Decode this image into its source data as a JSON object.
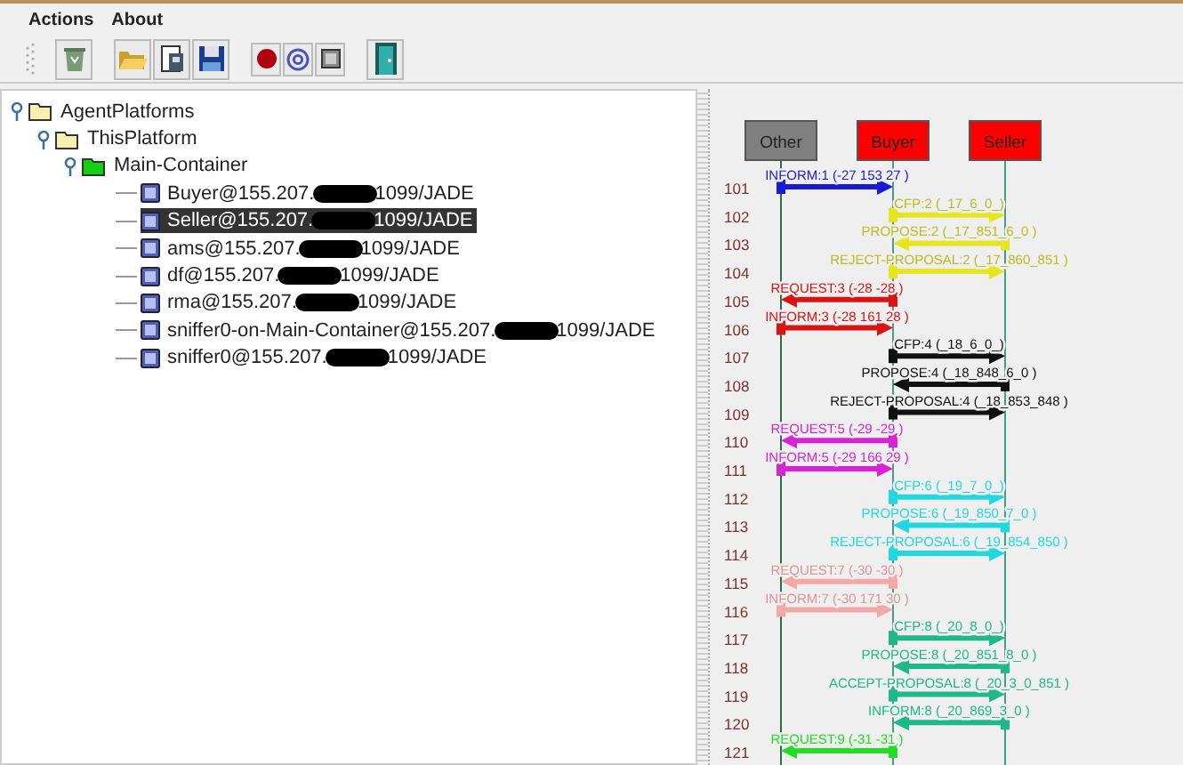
{
  "menu": [
    "Actions",
    "About"
  ],
  "tree": [
    {
      "label": "AgentPlatforms",
      "kind": "folder",
      "expanded": true,
      "children": [
        {
          "label": "ThisPlatform",
          "kind": "folder",
          "expanded": true,
          "children": [
            {
              "label": "Main-Container",
              "kind": "container",
              "expanded": true,
              "children": [
                {
                  "label_start": "Buyer@155.207.",
                  "label_end": "1099/JADE",
                  "selected": false
                },
                {
                  "label_start": "Seller@155.207.",
                  "label_end": "1099/JADE",
                  "selected": true
                },
                {
                  "label_start": "ams@155.207.",
                  "label_end": "1099/JADE",
                  "selected": false
                },
                {
                  "label_start": "df@155.207.",
                  "label_end": "1099/JADE",
                  "selected": false
                },
                {
                  "label_start": "rma@155.207.",
                  "label_end": "1099/JADE",
                  "selected": false
                },
                {
                  "label_start": "sniffer0-on-Main-Container@155.207.",
                  "label_end": "1099/JADE",
                  "selected": false
                },
                {
                  "label_start": "sniffer0@155.207.",
                  "label_end": "1099/JADE",
                  "selected": false
                }
              ]
            }
          ]
        }
      ]
    }
  ],
  "agents": [
    {
      "name": "Other",
      "color": "#808080"
    },
    {
      "name": "Buyer",
      "color": "#ff0000"
    },
    {
      "name": "Seller",
      "color": "#ff0000"
    }
  ],
  "messages": [
    {
      "number": "101",
      "label": "INFORM:1 (-27  153  27 )",
      "kind": "other_to_buyer",
      "color": "#1a1ad6"
    },
    {
      "number": "102",
      "label": "CFP:2 (_17_6_0_)",
      "kind": "buyer_to_seller",
      "color": "#e6e620"
    },
    {
      "number": "103",
      "label": "PROPOSE:2 (_17_851_6_0 )",
      "kind": "seller_to_buyer",
      "color": "#e6e620"
    },
    {
      "number": "104",
      "label": "REJECT-PROPOSAL:2 (_17_860_851 )",
      "kind": "buyer_to_seller",
      "color": "#e6e620"
    },
    {
      "number": "105",
      "label": "REQUEST:3 (-28  -28  )",
      "kind": "buyer_to_other",
      "color": "#d81414"
    },
    {
      "number": "106",
      "label": "INFORM:3 (-28  161  28 )",
      "kind": "other_to_buyer",
      "color": "#d81414"
    },
    {
      "number": "107",
      "label": "CFP:4 (_18_6_0_)",
      "kind": "buyer_to_seller",
      "color": "#111111"
    },
    {
      "number": "108",
      "label": "PROPOSE:4 (_18_848_6_0 )",
      "kind": "seller_to_buyer",
      "color": "#111111"
    },
    {
      "number": "109",
      "label": "REJECT-PROPOSAL:4 (_18_853_848 )",
      "kind": "buyer_to_seller",
      "color": "#111111"
    },
    {
      "number": "110",
      "label": "REQUEST:5 (-29  -29  )",
      "kind": "buyer_to_other",
      "color": "#d424d4"
    },
    {
      "number": "111",
      "label": "INFORM:5 (-29  166  29 )",
      "kind": "other_to_buyer",
      "color": "#d424d4"
    },
    {
      "number": "112",
      "label": "CFP:6 (_19_7_0_)",
      "kind": "buyer_to_seller",
      "color": "#22d8e0"
    },
    {
      "number": "113",
      "label": "PROPOSE:6 (_19_850_7_0 )",
      "kind": "seller_to_buyer",
      "color": "#22d8e0"
    },
    {
      "number": "114",
      "label": "REJECT-PROPOSAL:6 (_19_854_850 )",
      "kind": "buyer_to_seller",
      "color": "#22d8e0"
    },
    {
      "number": "115",
      "label": "REQUEST:7 (-30  -30  )",
      "kind": "buyer_to_other",
      "color": "#f2a8a8"
    },
    {
      "number": "116",
      "label": "INFORM:7 (-30  171  30 )",
      "kind": "other_to_buyer",
      "color": "#f2a8a8"
    },
    {
      "number": "117",
      "label": "CFP:8 (_20_8_0_)",
      "kind": "buyer_to_seller",
      "color": "#1fb888"
    },
    {
      "number": "118",
      "label": "PROPOSE:8 (_20_851_8_0 )",
      "kind": "seller_to_buyer",
      "color": "#1fb888"
    },
    {
      "number": "119",
      "label": "ACCEPT-PROPOSAL:8 (_20_3_0_851 )",
      "kind": "buyer_to_seller",
      "color": "#1fb888"
    },
    {
      "number": "120",
      "label": "INFORM:8 (_20_869_3_0 )",
      "kind": "seller_to_buyer",
      "color": "#1fb888"
    },
    {
      "number": "121",
      "label": "REQUEST:9 (-31  -31  )",
      "kind": "buyer_to_other",
      "color": "#22dd22"
    }
  ]
}
